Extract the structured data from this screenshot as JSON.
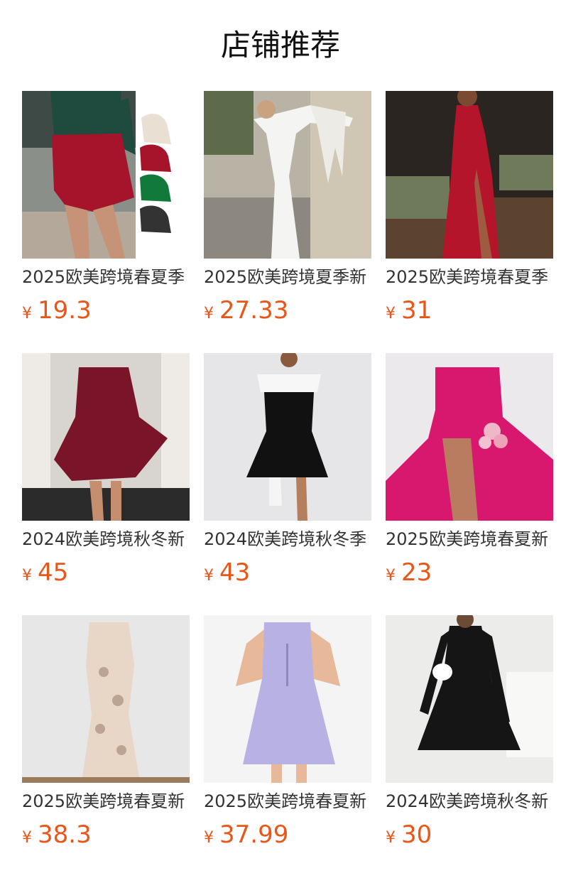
{
  "section_title": "店铺推荐",
  "currency_symbol": "¥",
  "products": [
    {
      "name": "2025欧美跨境春夏季",
      "price": "19.3",
      "image": "skirt-with-color-swatches",
      "colors": [
        "#e9dfd2",
        "#a5142a",
        "#117a3b",
        "#333333"
      ]
    },
    {
      "name": "2025欧美跨境夏季新",
      "price": "27.33",
      "image": "white-off-shoulder-ruffle-maxi-dress",
      "colors": [
        "#f4f4f2"
      ]
    },
    {
      "name": "2025欧美跨境春夏季",
      "price": "31",
      "image": "red-halter-slit-maxi-dress",
      "colors": [
        "#b5152b"
      ]
    },
    {
      "name": "2024欧美跨境秋冬新",
      "price": "45",
      "image": "burgundy-long-sleeve-choker-mini-dress",
      "colors": [
        "#7a1428"
      ]
    },
    {
      "name": "2024欧美跨境秋冬季",
      "price": "43",
      "image": "black-white-off-shoulder-mini-dress",
      "colors": [
        "#111111",
        "#f5f5f5"
      ]
    },
    {
      "name": "2025欧美跨境春夏新",
      "price": "23",
      "image": "pink-satin-slip-dress-with-roses",
      "colors": [
        "#d8186e"
      ]
    },
    {
      "name": "2025欧美跨境春夏新",
      "price": "38.3",
      "image": "floral-print-slip-midi-dress",
      "colors": [
        "#e8d6c6"
      ]
    },
    {
      "name": "2025欧美跨境春夏新",
      "price": "37.99",
      "image": "lavender-zip-tennis-dress",
      "colors": [
        "#b8b2e4"
      ]
    },
    {
      "name": "2024欧美跨境秋冬新",
      "price": "30",
      "image": "black-ribbed-long-sleeve-dress",
      "colors": [
        "#151515"
      ]
    }
  ]
}
